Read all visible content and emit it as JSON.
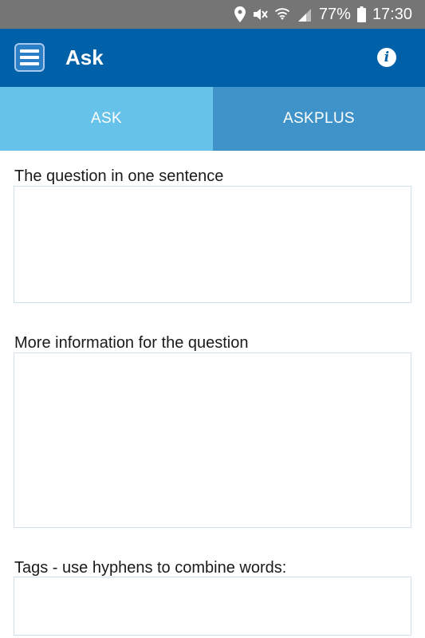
{
  "status_bar": {
    "battery": "77%",
    "time": "17:30",
    "icons": [
      "location-icon",
      "mute-icon",
      "wifi-icon",
      "signal-icon",
      "battery-icon"
    ]
  },
  "app_bar": {
    "title": "Ask",
    "menu_icon": "hamburger-menu-icon",
    "info_icon": "i"
  },
  "tabs": [
    {
      "label": "ASK",
      "selected": true
    },
    {
      "label": "ASKPLUS",
      "selected": false
    }
  ],
  "form": {
    "question_label": "The question in one sentence",
    "question_value": "",
    "more_info_label": "More information for the question",
    "more_info_value": "",
    "tags_label": "Tags - use hyphens to combine words:",
    "tags_value": ""
  },
  "colors": {
    "status_bar": "#757575",
    "app_bar": "#0061a8",
    "tab_selected": "#66c2e9",
    "tab_unselected": "#3f93c8"
  }
}
